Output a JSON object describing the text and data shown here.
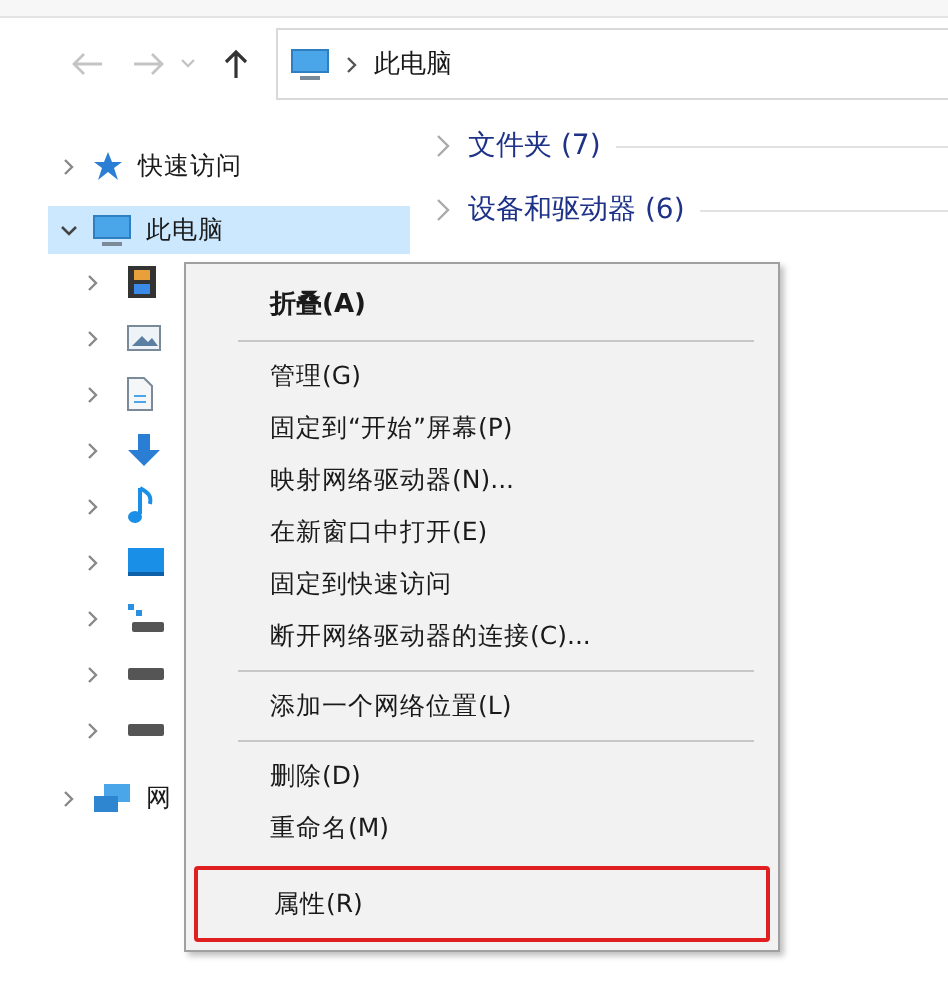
{
  "address_bar": {
    "location": "此电脑"
  },
  "sidebar": {
    "items": [
      {
        "label": "快速访问",
        "kind": "star",
        "expanded": false,
        "selected": false
      },
      {
        "label": "此电脑",
        "kind": "pc",
        "expanded": true,
        "selected": true,
        "children": [
          {
            "kind": "videos",
            "expanded": false
          },
          {
            "kind": "pictures",
            "expanded": false
          },
          {
            "kind": "documents",
            "expanded": false
          },
          {
            "kind": "downloads",
            "expanded": false
          },
          {
            "kind": "music",
            "expanded": false
          },
          {
            "kind": "desktop",
            "expanded": false
          },
          {
            "kind": "netdrive",
            "expanded": false
          },
          {
            "kind": "drive",
            "expanded": false
          },
          {
            "kind": "drive",
            "expanded": false
          }
        ]
      },
      {
        "label": "网",
        "kind": "network",
        "expanded": false,
        "selected": false
      }
    ]
  },
  "groups": [
    {
      "label": "文件夹 (7)",
      "expanded": false
    },
    {
      "label": "设备和驱动器 (6)",
      "expanded": false
    }
  ],
  "context_menu": {
    "items": [
      {
        "kind": "item",
        "label": "折叠(A)",
        "default": true,
        "highlighted": false
      },
      {
        "kind": "separator"
      },
      {
        "kind": "item",
        "label": "管理(G)",
        "default": false,
        "highlighted": false
      },
      {
        "kind": "item",
        "label": "固定到“开始”屏幕(P)",
        "default": false,
        "highlighted": false
      },
      {
        "kind": "item",
        "label": "映射网络驱动器(N)...",
        "default": false,
        "highlighted": false
      },
      {
        "kind": "item",
        "label": "在新窗口中打开(E)",
        "default": false,
        "highlighted": false
      },
      {
        "kind": "item",
        "label": "固定到快速访问",
        "default": false,
        "highlighted": false
      },
      {
        "kind": "item",
        "label": "断开网络驱动器的连接(C)...",
        "default": false,
        "highlighted": false
      },
      {
        "kind": "separator"
      },
      {
        "kind": "item",
        "label": "添加一个网络位置(L)",
        "default": false,
        "highlighted": false
      },
      {
        "kind": "separator"
      },
      {
        "kind": "item",
        "label": "删除(D)",
        "default": false,
        "highlighted": false
      },
      {
        "kind": "item",
        "label": "重命名(M)",
        "default": false,
        "highlighted": false
      },
      {
        "kind": "item",
        "label": "属性(R)",
        "default": false,
        "highlighted": true
      }
    ]
  }
}
